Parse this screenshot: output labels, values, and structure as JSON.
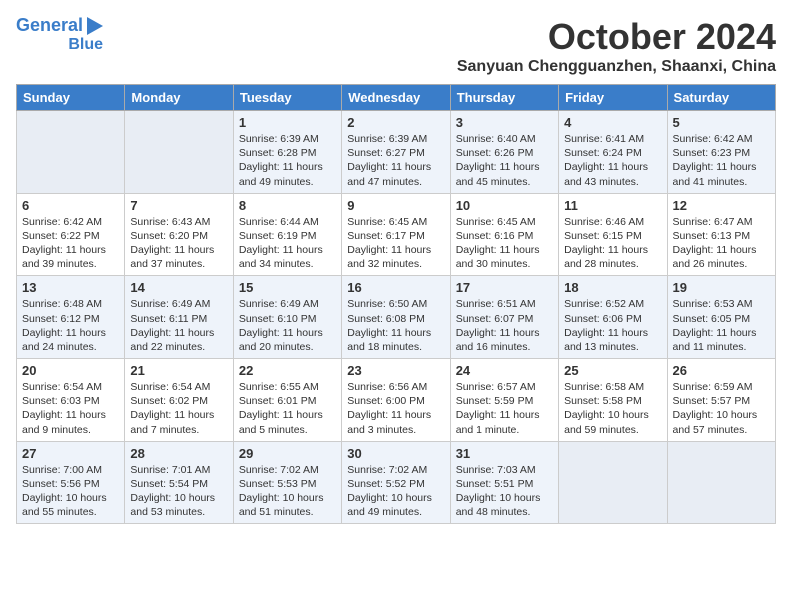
{
  "header": {
    "logo_line1": "General",
    "logo_line2": "Blue",
    "title": "October 2024",
    "subtitle": "Sanyuan Chengguanzhen, Shaanxi, China"
  },
  "calendar": {
    "days_of_week": [
      "Sunday",
      "Monday",
      "Tuesday",
      "Wednesday",
      "Thursday",
      "Friday",
      "Saturday"
    ],
    "weeks": [
      [
        {
          "day": "",
          "info": ""
        },
        {
          "day": "",
          "info": ""
        },
        {
          "day": "1",
          "info": "Sunrise: 6:39 AM\nSunset: 6:28 PM\nDaylight: 11 hours and 49 minutes."
        },
        {
          "day": "2",
          "info": "Sunrise: 6:39 AM\nSunset: 6:27 PM\nDaylight: 11 hours and 47 minutes."
        },
        {
          "day": "3",
          "info": "Sunrise: 6:40 AM\nSunset: 6:26 PM\nDaylight: 11 hours and 45 minutes."
        },
        {
          "day": "4",
          "info": "Sunrise: 6:41 AM\nSunset: 6:24 PM\nDaylight: 11 hours and 43 minutes."
        },
        {
          "day": "5",
          "info": "Sunrise: 6:42 AM\nSunset: 6:23 PM\nDaylight: 11 hours and 41 minutes."
        }
      ],
      [
        {
          "day": "6",
          "info": "Sunrise: 6:42 AM\nSunset: 6:22 PM\nDaylight: 11 hours and 39 minutes."
        },
        {
          "day": "7",
          "info": "Sunrise: 6:43 AM\nSunset: 6:20 PM\nDaylight: 11 hours and 37 minutes."
        },
        {
          "day": "8",
          "info": "Sunrise: 6:44 AM\nSunset: 6:19 PM\nDaylight: 11 hours and 34 minutes."
        },
        {
          "day": "9",
          "info": "Sunrise: 6:45 AM\nSunset: 6:17 PM\nDaylight: 11 hours and 32 minutes."
        },
        {
          "day": "10",
          "info": "Sunrise: 6:45 AM\nSunset: 6:16 PM\nDaylight: 11 hours and 30 minutes."
        },
        {
          "day": "11",
          "info": "Sunrise: 6:46 AM\nSunset: 6:15 PM\nDaylight: 11 hours and 28 minutes."
        },
        {
          "day": "12",
          "info": "Sunrise: 6:47 AM\nSunset: 6:13 PM\nDaylight: 11 hours and 26 minutes."
        }
      ],
      [
        {
          "day": "13",
          "info": "Sunrise: 6:48 AM\nSunset: 6:12 PM\nDaylight: 11 hours and 24 minutes."
        },
        {
          "day": "14",
          "info": "Sunrise: 6:49 AM\nSunset: 6:11 PM\nDaylight: 11 hours and 22 minutes."
        },
        {
          "day": "15",
          "info": "Sunrise: 6:49 AM\nSunset: 6:10 PM\nDaylight: 11 hours and 20 minutes."
        },
        {
          "day": "16",
          "info": "Sunrise: 6:50 AM\nSunset: 6:08 PM\nDaylight: 11 hours and 18 minutes."
        },
        {
          "day": "17",
          "info": "Sunrise: 6:51 AM\nSunset: 6:07 PM\nDaylight: 11 hours and 16 minutes."
        },
        {
          "day": "18",
          "info": "Sunrise: 6:52 AM\nSunset: 6:06 PM\nDaylight: 11 hours and 13 minutes."
        },
        {
          "day": "19",
          "info": "Sunrise: 6:53 AM\nSunset: 6:05 PM\nDaylight: 11 hours and 11 minutes."
        }
      ],
      [
        {
          "day": "20",
          "info": "Sunrise: 6:54 AM\nSunset: 6:03 PM\nDaylight: 11 hours and 9 minutes."
        },
        {
          "day": "21",
          "info": "Sunrise: 6:54 AM\nSunset: 6:02 PM\nDaylight: 11 hours and 7 minutes."
        },
        {
          "day": "22",
          "info": "Sunrise: 6:55 AM\nSunset: 6:01 PM\nDaylight: 11 hours and 5 minutes."
        },
        {
          "day": "23",
          "info": "Sunrise: 6:56 AM\nSunset: 6:00 PM\nDaylight: 11 hours and 3 minutes."
        },
        {
          "day": "24",
          "info": "Sunrise: 6:57 AM\nSunset: 5:59 PM\nDaylight: 11 hours and 1 minute."
        },
        {
          "day": "25",
          "info": "Sunrise: 6:58 AM\nSunset: 5:58 PM\nDaylight: 10 hours and 59 minutes."
        },
        {
          "day": "26",
          "info": "Sunrise: 6:59 AM\nSunset: 5:57 PM\nDaylight: 10 hours and 57 minutes."
        }
      ],
      [
        {
          "day": "27",
          "info": "Sunrise: 7:00 AM\nSunset: 5:56 PM\nDaylight: 10 hours and 55 minutes."
        },
        {
          "day": "28",
          "info": "Sunrise: 7:01 AM\nSunset: 5:54 PM\nDaylight: 10 hours and 53 minutes."
        },
        {
          "day": "29",
          "info": "Sunrise: 7:02 AM\nSunset: 5:53 PM\nDaylight: 10 hours and 51 minutes."
        },
        {
          "day": "30",
          "info": "Sunrise: 7:02 AM\nSunset: 5:52 PM\nDaylight: 10 hours and 49 minutes."
        },
        {
          "day": "31",
          "info": "Sunrise: 7:03 AM\nSunset: 5:51 PM\nDaylight: 10 hours and 48 minutes."
        },
        {
          "day": "",
          "info": ""
        },
        {
          "day": "",
          "info": ""
        }
      ]
    ]
  }
}
